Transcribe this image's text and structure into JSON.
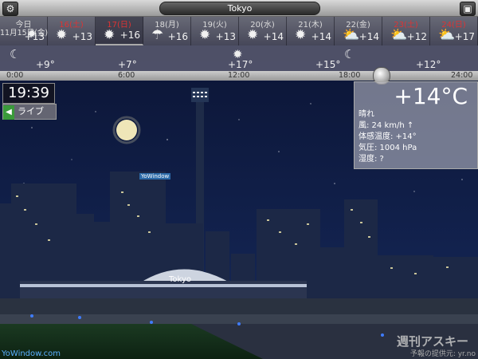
{
  "window": {
    "city": "Tokyo"
  },
  "icons": {
    "settings": "gear-icon",
    "gallery": "image-icon"
  },
  "days": [
    {
      "label": "今日",
      "sub": "11月15日(金)",
      "temp": "+13",
      "icon": "sun-icon",
      "red": false,
      "selected": false
    },
    {
      "label": "16(土)",
      "temp": "+13",
      "icon": "sun-icon",
      "red": true,
      "selected": false
    },
    {
      "label": "17(日)",
      "temp": "+16",
      "icon": "sun-icon",
      "red": true,
      "selected": true
    },
    {
      "label": "18(月)",
      "temp": "+16",
      "icon": "rain-icon",
      "red": false,
      "selected": false
    },
    {
      "label": "19(火)",
      "temp": "+13",
      "icon": "sun-icon",
      "red": false,
      "selected": false
    },
    {
      "label": "20(水)",
      "temp": "+14",
      "icon": "sun-icon",
      "red": false,
      "selected": false
    },
    {
      "label": "21(木)",
      "temp": "+14",
      "icon": "sun-icon",
      "red": false,
      "selected": false
    },
    {
      "label": "22(金)",
      "temp": "+14",
      "icon": "partly-cloudy-icon",
      "red": false,
      "selected": false
    },
    {
      "label": "23(土)",
      "temp": "+12",
      "icon": "partly-cloudy-icon",
      "red": true,
      "selected": false
    },
    {
      "label": "24(日)",
      "temp": "+17",
      "icon": "partly-cloudy-icon",
      "red": true,
      "selected": false
    }
  ],
  "hourly": [
    {
      "temp": "+9°",
      "icon": "moon-icon"
    },
    {
      "temp": "+7°",
      "icon": ""
    },
    {
      "temp": "+17°",
      "icon": "sun-icon"
    },
    {
      "temp": "+15°",
      "icon": "moon-icon"
    },
    {
      "temp": "+12°",
      "icon": ""
    }
  ],
  "timeline": [
    "0:00",
    "6:00",
    "12:00",
    "18:00",
    "24:00"
  ],
  "clock": "19:39",
  "live_label": "ライブ",
  "current": {
    "temp": "+14°C",
    "condition": "晴れ",
    "wind": "風:  24 km/h",
    "feels": "体感温度: +14°",
    "pressure": "気圧: 1004 hPa",
    "humidity": "湿度: ?"
  },
  "footer": {
    "left": "YoWindow.com",
    "watermark": "週刊アスキー",
    "credit": "予報の提供元: yr.no"
  },
  "scene": {
    "city_sign": "Tokyo",
    "building_sign": "YoWindow"
  }
}
